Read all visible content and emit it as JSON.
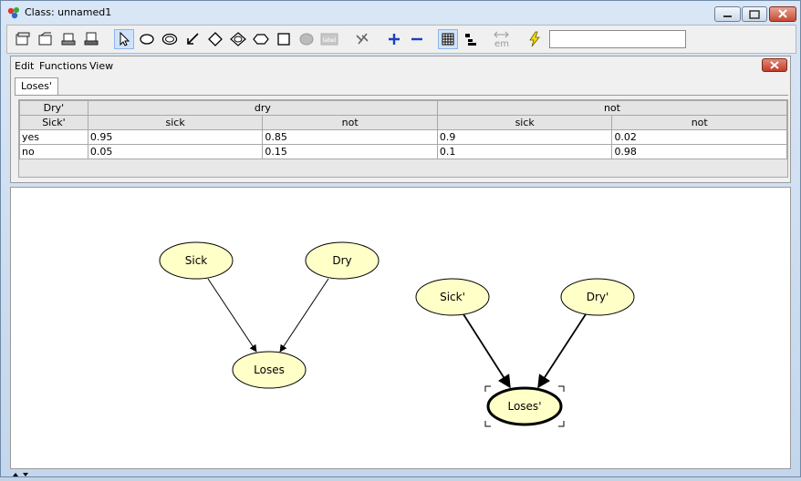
{
  "window": {
    "title": "Class: unnamed1"
  },
  "toolbar": {
    "icons": [
      "new-class-icon",
      "open-icon",
      "save-icon",
      "print-icon",
      "select-arrow-icon",
      "chance-node-icon",
      "decision-node-icon",
      "link-arrow-icon",
      "utility-node-icon",
      "discrete-node-icon",
      "function-node-icon",
      "instance-node-icon",
      "continuous-node-icon",
      "label-icon",
      "hide-links-icon",
      "zoom-in-icon",
      "zoom-out-icon",
      "table-view-icon",
      "tree-view-icon",
      "em-learning-icon",
      "compile-icon"
    ],
    "label_icon_text": "label",
    "em_text": "em",
    "search_value": ""
  },
  "menu": {
    "items": [
      "Edit",
      "Functions",
      "View"
    ]
  },
  "tab": {
    "label": "Loses'"
  },
  "table": {
    "parent1_name": "Dry'",
    "parent2_name": "Sick'",
    "parent1_states": [
      "dry",
      "not"
    ],
    "parent2_states": [
      "sick",
      "not",
      "sick",
      "not"
    ],
    "rows": [
      {
        "label": "yes",
        "values": [
          "0.95",
          "0.85",
          "0.9",
          "0.02"
        ]
      },
      {
        "label": "no",
        "values": [
          "0.05",
          "0.15",
          "0.1",
          "0.98"
        ]
      }
    ]
  },
  "network": {
    "nodes": [
      {
        "id": "sick",
        "label": "Sick"
      },
      {
        "id": "dry",
        "label": "Dry"
      },
      {
        "id": "loses",
        "label": "Loses"
      },
      {
        "id": "sick2",
        "label": "Sick'"
      },
      {
        "id": "dry2",
        "label": "Dry'"
      },
      {
        "id": "loses2",
        "label": "Loses'",
        "selected": true
      }
    ],
    "edges": [
      [
        "sick",
        "loses"
      ],
      [
        "dry",
        "loses"
      ],
      [
        "sick2",
        "loses2"
      ],
      [
        "dry2",
        "loses2"
      ]
    ],
    "node_fill": "#ffffc8"
  }
}
